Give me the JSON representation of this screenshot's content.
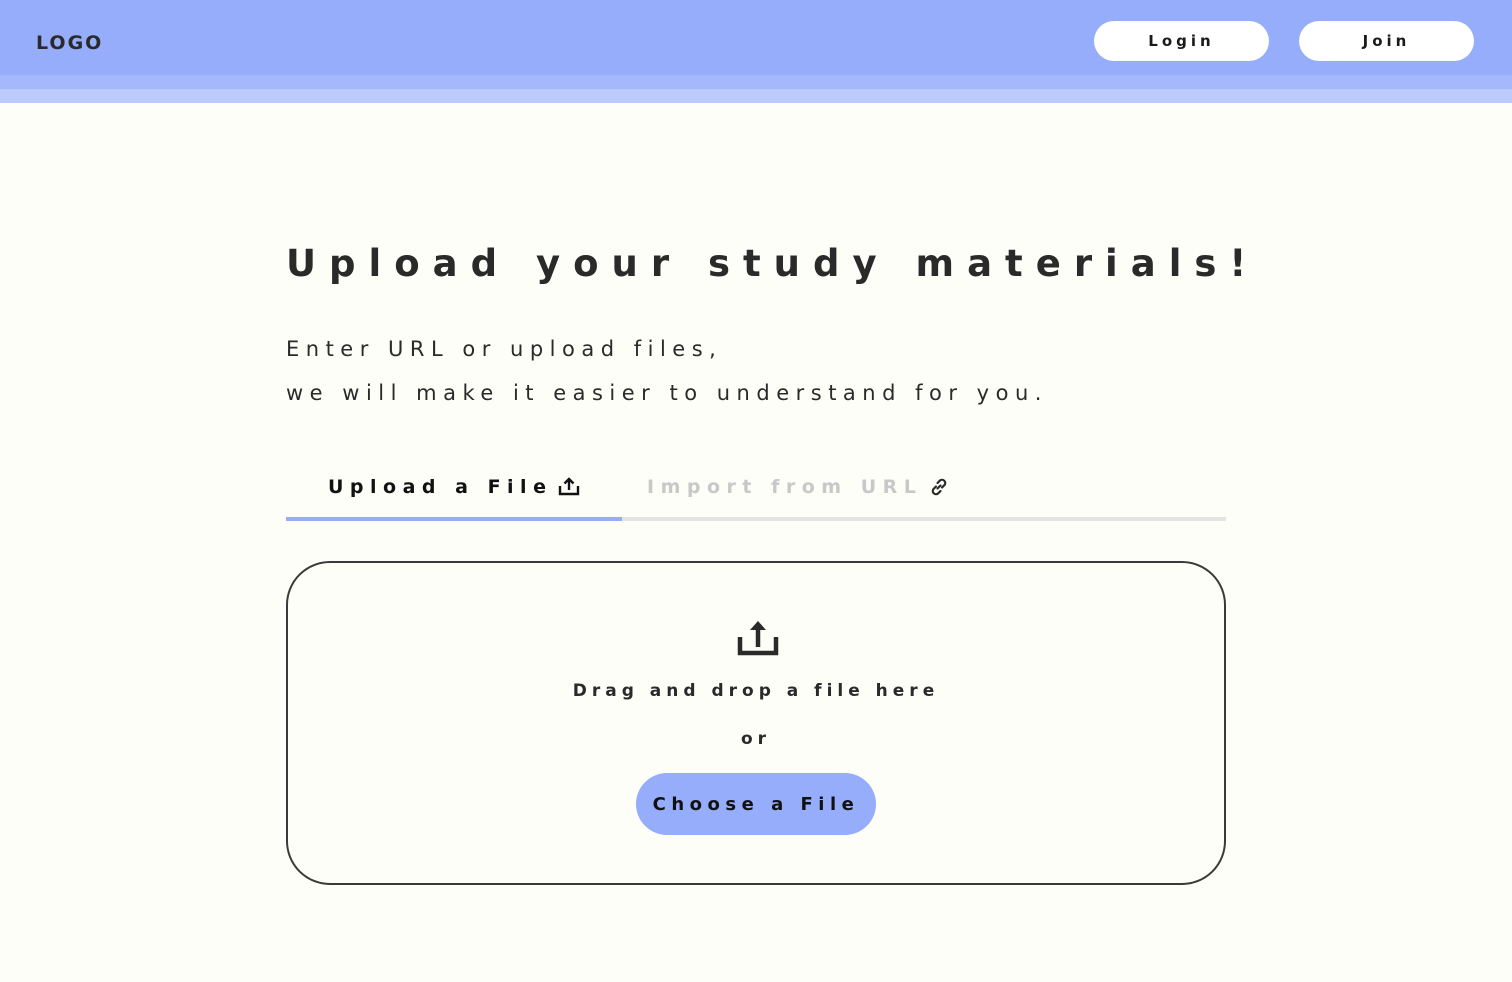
{
  "header": {
    "logo": "LOGO",
    "login_label": "Login",
    "join_label": "Join"
  },
  "main": {
    "title": "Upload your study materials!",
    "subtitle_line1": "Enter URL or upload files,",
    "subtitle_line2": "we will make it easier to understand for you."
  },
  "tabs": [
    {
      "label": "Upload a File",
      "icon": "upload-icon",
      "active": true
    },
    {
      "label": "Import from URL",
      "icon": "link-icon",
      "active": false
    }
  ],
  "dropzone": {
    "icon": "upload-icon",
    "drag_text": "Drag and drop a file here",
    "or_text": "or",
    "choose_label": "Choose a File"
  },
  "colors": {
    "accent": "#95adfa",
    "background": "#fefef8",
    "text": "#2a2a2a",
    "inactive_tab": "#c8c8c8"
  }
}
